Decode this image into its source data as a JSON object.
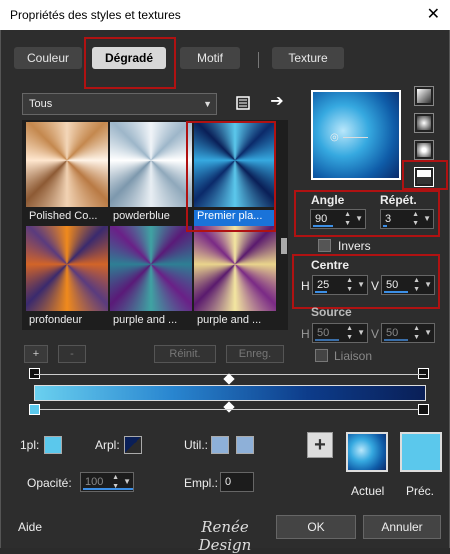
{
  "window": {
    "title": "Propriétés des styles et textures",
    "close": "✕"
  },
  "tabs": [
    {
      "label": "Couleur"
    },
    {
      "label": "Dégradé"
    },
    {
      "label": "Motif"
    },
    {
      "label": "Texture"
    }
  ],
  "library": {
    "selected": "Tous"
  },
  "gallery": [
    {
      "label": "Polished Co..."
    },
    {
      "label": "powderblue"
    },
    {
      "label": "Premier pla..."
    },
    {
      "label": "profondeur"
    },
    {
      "label": "purple and ..."
    },
    {
      "label": "purple and ..."
    }
  ],
  "gallery_actions": {
    "add": "+",
    "remove": "-",
    "reset": "Réinit.",
    "save": "Enreg."
  },
  "angle": {
    "label": "Angle",
    "value": "90"
  },
  "repeat": {
    "label": "Répét.",
    "value": "3"
  },
  "invert": {
    "label": "Invers"
  },
  "center": {
    "label": "Centre",
    "h_label": "H",
    "h_value": "25",
    "v_label": "V",
    "v_value": "50"
  },
  "source": {
    "label": "Source",
    "h_label": "H",
    "h_value": "50",
    "v_label": "V",
    "v_value": "50"
  },
  "link": {
    "label": "Liaison"
  },
  "stops": {
    "first_label": "1pl:",
    "bg_label": "Arpl:",
    "user_label": "Util.:",
    "opacity_label": "Opacité:",
    "opacity_value": "100",
    "location_label": "Empl.:",
    "location_value": "0"
  },
  "preview": {
    "current_label": "Actuel",
    "previous_label": "Préc."
  },
  "footer": {
    "help": "Aide",
    "logo": "Renée Design",
    "ok": "OK",
    "cancel": "Annuler"
  },
  "colors": {
    "accent": "#1a73d9",
    "highlight": "#b01212",
    "light_blue": "#5bc8ec",
    "dark_navy": "#0a1f57"
  },
  "icons": [
    "close-icon",
    "library-browse-icon",
    "arrow-right-icon",
    "linear-gradient-icon",
    "radial-gradient-icon",
    "rectangular-gradient-icon",
    "sunburst-gradient-icon"
  ]
}
